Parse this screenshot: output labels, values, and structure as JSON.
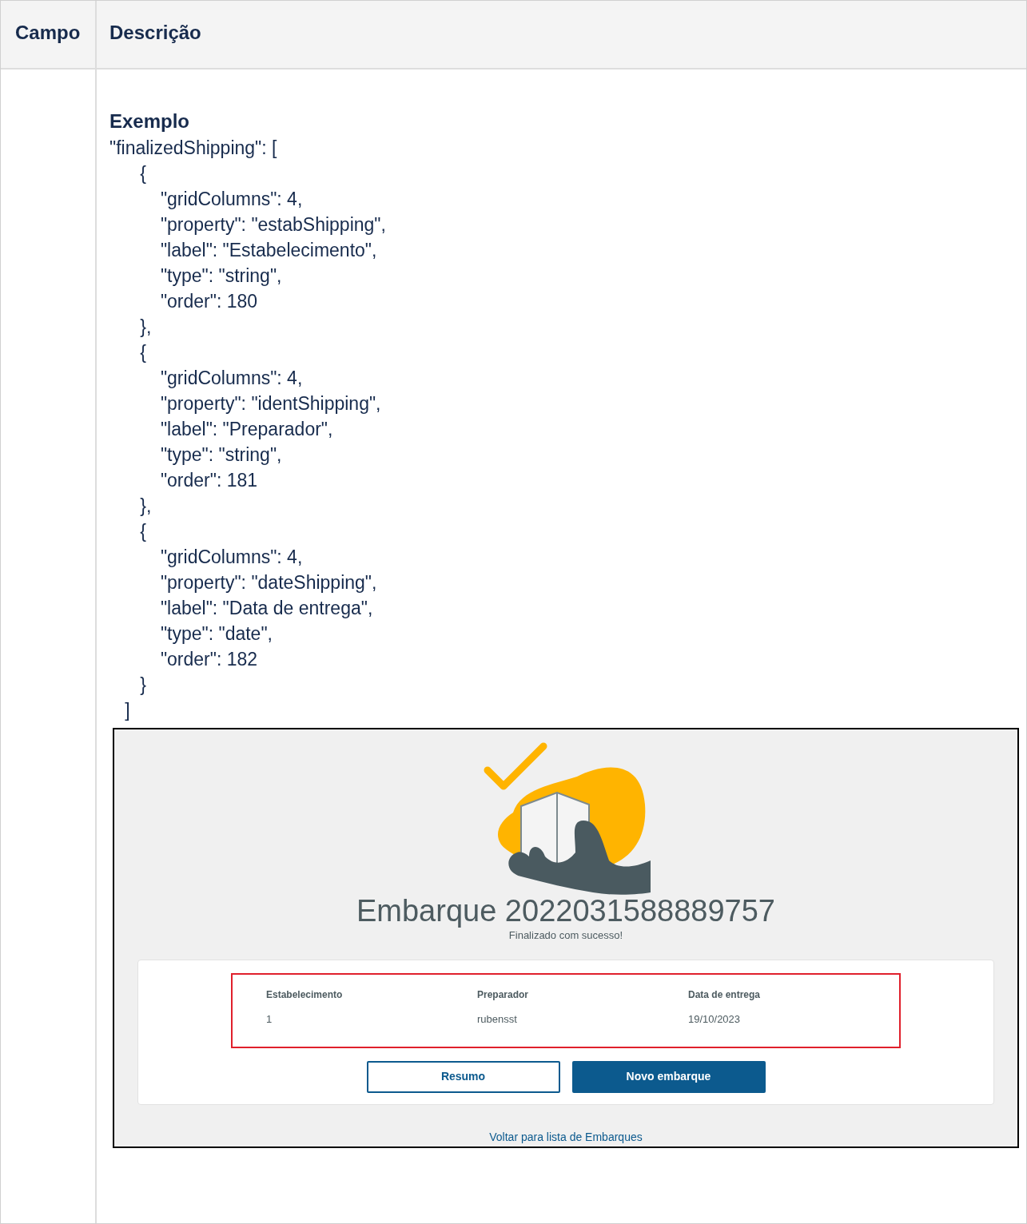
{
  "table": {
    "columns": [
      "Campo",
      "Descrição"
    ],
    "rows": [
      {
        "campo": "",
        "example_title": "Exemplo",
        "code_lines": [
          "\"finalizedShipping\": [",
          "      {",
          "          \"gridColumns\": 4,",
          "          \"property\": \"estabShipping\",",
          "          \"label\": \"Estabelecimento\",",
          "          \"type\": \"string\",",
          "          \"order\": 180",
          "      },",
          "      {",
          "          \"gridColumns\": 4,",
          "          \"property\": \"identShipping\",",
          "          \"label\": \"Preparador\",",
          "          \"type\": \"string\",",
          "          \"order\": 181",
          "      },",
          "      {",
          "          \"gridColumns\": 4,",
          "          \"property\": \"dateShipping\",",
          "          \"label\": \"Data de entrega\",",
          "          \"type\": \"date\",",
          "          \"order\": 182",
          "      }",
          "   ]"
        ],
        "screenshot": {
          "title": "Embarque 2022031588889757",
          "subtitle": "Finalizado com sucesso!",
          "fields": [
            {
              "label": "Estabelecimento",
              "value": "1"
            },
            {
              "label": "Preparador",
              "value": "rubensst"
            },
            {
              "label": "Data de entrega",
              "value": "19/10/2023"
            }
          ],
          "buttons": [
            {
              "label": "Resumo",
              "kind": "secondary"
            },
            {
              "label": "Novo embarque",
              "kind": "primary"
            }
          ],
          "link": "Voltar para lista de Embarques"
        }
      }
    ]
  }
}
